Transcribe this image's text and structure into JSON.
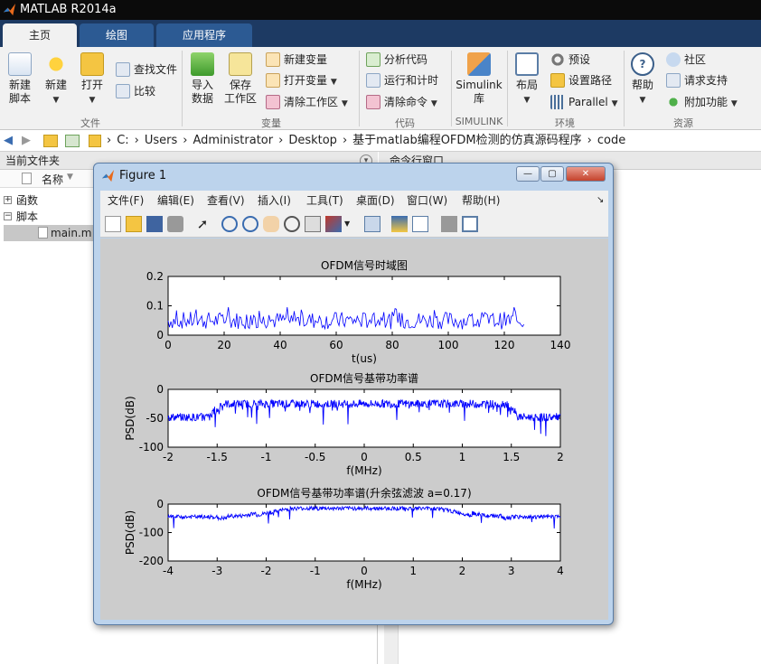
{
  "app": {
    "title": "MATLAB R2014a"
  },
  "tabs": [
    {
      "label": "主页"
    },
    {
      "label": "绘图"
    },
    {
      "label": "应用程序"
    }
  ],
  "ribbon": {
    "file": {
      "new_script": "新建\n脚本",
      "new": "新建",
      "open": "打开",
      "find_files": "查找文件",
      "compare": "比较",
      "group": "文件"
    },
    "variable": {
      "import": "导入\n数据",
      "save": "保存\n工作区",
      "new_var": "新建变量",
      "open_var": "打开变量",
      "clear_ws": "清除工作区",
      "group": "变量"
    },
    "code": {
      "analyze": "分析代码",
      "run_time": "运行和计时",
      "clear_cmd": "清除命令",
      "group": "代码"
    },
    "simulink": {
      "lib": "Simulink\n库",
      "group": "SIMULINK"
    },
    "env": {
      "layout": "布局",
      "prefs": "预设",
      "set_path": "设置路径",
      "parallel": "Parallel",
      "group": "环境"
    },
    "resources": {
      "help": "帮助",
      "community": "社区",
      "support": "请求支持",
      "addons": "附加功能",
      "group": "资源"
    }
  },
  "address": {
    "crumbs": [
      "C:",
      "Users",
      "Administrator",
      "Desktop",
      "基于matlab编程OFDM检测的仿真源码程序",
      "code"
    ]
  },
  "left_panel": {
    "title": "当前文件夹",
    "col_name": "名称",
    "tree": [
      {
        "label": "函数",
        "sign": "+"
      },
      {
        "label": "脚本",
        "sign": "−"
      }
    ],
    "file": "main.m"
  },
  "right_panel": {
    "title": "命令行窗口"
  },
  "figure": {
    "title": "Figure 1",
    "menus": [
      "文件(F)",
      "编辑(E)",
      "查看(V)",
      "插入(I)",
      "工具(T)",
      "桌面(D)",
      "窗口(W)",
      "帮助(H)"
    ]
  },
  "colors": {
    "trace": "#0000ff",
    "ribbon_bg": "#f1f1f1",
    "tab_bar": "#1d3a63",
    "figure_bg": "#cccccc"
  },
  "chart_data": [
    {
      "type": "line",
      "title": "OFDM信号时域图",
      "xlabel": "t(us)",
      "ylabel": "",
      "xlim": [
        0,
        140
      ],
      "ylim": [
        0,
        0.2
      ],
      "xticks": [
        "0",
        "20",
        "40",
        "60",
        "80",
        "100",
        "120",
        "140"
      ],
      "yticks": [
        "0",
        "0.1",
        "0.2"
      ],
      "series": [
        {
          "x_range": [
            0,
            127
          ],
          "mean": 0.05,
          "spread": 0.03,
          "max": 0.14
        }
      ]
    },
    {
      "type": "line",
      "title": "OFDM信号基带功率谱",
      "xlabel": "f(MHz)",
      "ylabel": "PSD(dB)",
      "xlim": [
        -2,
        2
      ],
      "ylim": [
        -100,
        0
      ],
      "xticks": [
        "-2",
        "-1.5",
        "-1",
        "-0.5",
        "0",
        "0.5",
        "1",
        "1.5",
        "2"
      ],
      "yticks": [
        "0",
        "-50",
        "-100"
      ],
      "series": [
        {
          "passband": [
            -1.5,
            1.5
          ],
          "inband_db": -25,
          "outband_db": -48
        }
      ]
    },
    {
      "type": "line",
      "title": "OFDM信号基带功率谱(升余弦滤波 a=0.17)",
      "xlabel": "f(MHz)",
      "ylabel": "PSD(dB)",
      "xlim": [
        -4,
        4
      ],
      "ylim": [
        -200,
        0
      ],
      "xticks": [
        "-4",
        "-3",
        "-2",
        "-1",
        "0",
        "1",
        "2",
        "3",
        "4"
      ],
      "yticks": [
        "0",
        "-100",
        "-200"
      ],
      "series": [
        {
          "passband": [
            -1.5,
            1.5
          ],
          "inband_db": -15,
          "outband_db": -50
        }
      ]
    }
  ]
}
